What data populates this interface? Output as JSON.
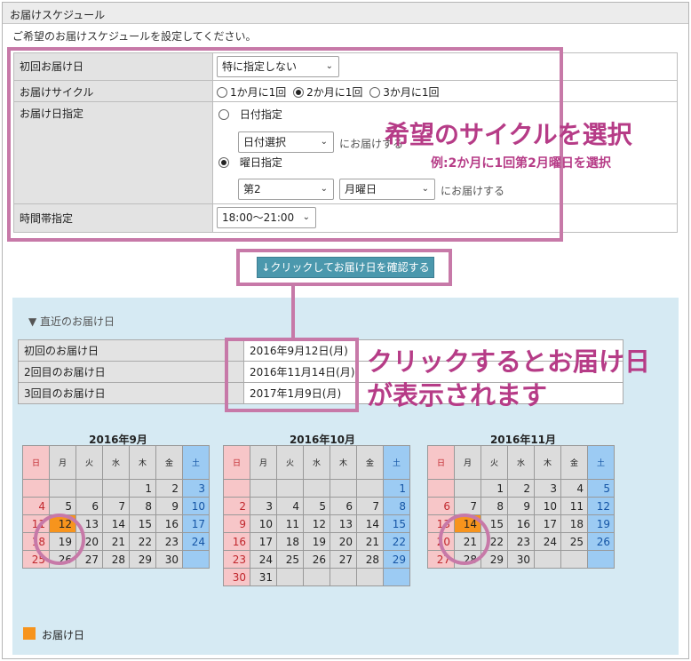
{
  "header": {
    "title": "お届けスケジュール"
  },
  "subtitle": "ご希望のお届けスケジュールを設定してください。",
  "form": {
    "first_date": {
      "label": "初回お届け日",
      "value": "特に指定しない"
    },
    "cycle": {
      "label": "お届けサイクル",
      "options": [
        "1か月に1回",
        "2か月に1回",
        "3か月に1回"
      ],
      "selected_index": 1
    },
    "date_spec": {
      "label": "お届け日指定",
      "date_option": {
        "label": "日付指定",
        "select_value": "日付選択",
        "suffix": "にお届けする"
      },
      "weekday_option": {
        "label": "曜日指定",
        "week_value": "第2",
        "day_value": "月曜日",
        "suffix": "にお届けする"
      }
    },
    "time": {
      "label": "時間帯指定",
      "value": "18:00〜21:00"
    }
  },
  "annotations": {
    "cycle_title": "希望のサイクルを選択",
    "cycle_example": "例:2か月に1回第2月曜日を選択",
    "click_line1": "クリックするとお届け日",
    "click_line2": "が表示されます"
  },
  "confirm_button": "↓クリックしてお届け日を確認する",
  "upcoming": {
    "title": "▼ 直近のお届け日",
    "rows": [
      {
        "label": "初回のお届け日",
        "date": "2016年9月12日(月)"
      },
      {
        "label": "2回目のお届け日",
        "date": "2016年11月14日(月)"
      },
      {
        "label": "3回目のお届け日",
        "date": "2017年1月9日(月)"
      }
    ]
  },
  "calendars": [
    {
      "title": "2016年9月",
      "weekdays": [
        "日",
        "月",
        "火",
        "水",
        "木",
        "金",
        "土"
      ],
      "weeks": [
        [
          "",
          "",
          "",
          "",
          "1",
          "2",
          "3"
        ],
        [
          "4",
          "5",
          "6",
          "7",
          "8",
          "9",
          "10"
        ],
        [
          "11",
          "12",
          "13",
          "14",
          "15",
          "16",
          "17"
        ],
        [
          "18",
          "19",
          "20",
          "21",
          "22",
          "23",
          "24"
        ],
        [
          "25",
          "26",
          "27",
          "28",
          "29",
          "30",
          ""
        ]
      ],
      "delivery_day": "12"
    },
    {
      "title": "2016年10月",
      "weekdays": [
        "日",
        "月",
        "火",
        "水",
        "木",
        "金",
        "土"
      ],
      "weeks": [
        [
          "",
          "",
          "",
          "",
          "",
          "",
          "1"
        ],
        [
          "2",
          "3",
          "4",
          "5",
          "6",
          "7",
          "8"
        ],
        [
          "9",
          "10",
          "11",
          "12",
          "13",
          "14",
          "15"
        ],
        [
          "16",
          "17",
          "18",
          "19",
          "20",
          "21",
          "22"
        ],
        [
          "23",
          "24",
          "25",
          "26",
          "27",
          "28",
          "29"
        ],
        [
          "30",
          "31",
          "",
          "",
          "",
          "",
          ""
        ]
      ],
      "delivery_day": ""
    },
    {
      "title": "2016年11月",
      "weekdays": [
        "日",
        "月",
        "火",
        "水",
        "木",
        "金",
        "土"
      ],
      "weeks": [
        [
          "",
          "",
          "1",
          "2",
          "3",
          "4",
          "5"
        ],
        [
          "6",
          "7",
          "8",
          "9",
          "10",
          "11",
          "12"
        ],
        [
          "13",
          "14",
          "15",
          "16",
          "17",
          "18",
          "19"
        ],
        [
          "20",
          "21",
          "22",
          "23",
          "24",
          "25",
          "26"
        ],
        [
          "27",
          "28",
          "29",
          "30",
          "",
          "",
          ""
        ]
      ],
      "delivery_day": "14"
    }
  ],
  "legend": {
    "label": "お届け日",
    "color": "#f7941d"
  },
  "colors": {
    "accent": "#c779a8",
    "button": "#4b98ad",
    "panel": "#d6eaf3",
    "sunday": "#f7c6c8",
    "saturday": "#9ccbf3"
  }
}
